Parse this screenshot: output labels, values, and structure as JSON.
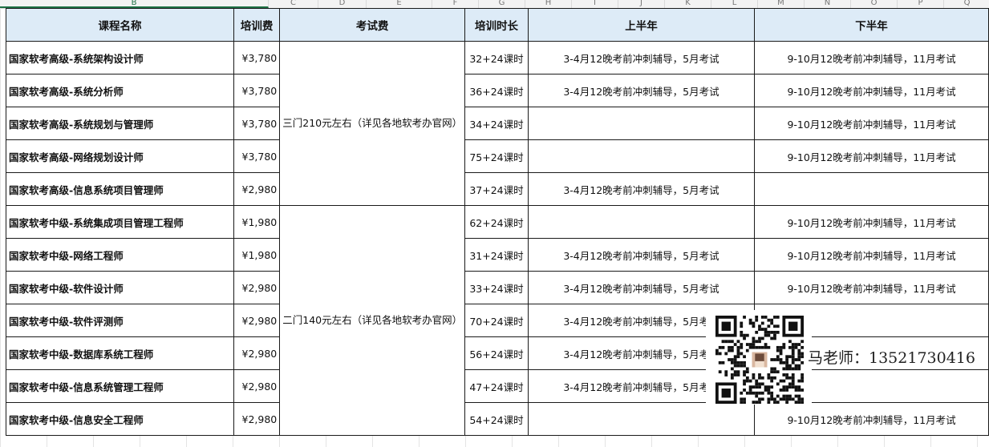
{
  "columns": [
    "B",
    "C",
    "D",
    "E",
    "F",
    "G",
    "H",
    "I",
    "J",
    "K",
    "L",
    "M",
    "N",
    "O",
    "P",
    "Q"
  ],
  "header": {
    "course": "课程名称",
    "training_fee": "培训费",
    "exam_fee": "考试费",
    "duration": "培训时长",
    "first_half": "上半年",
    "second_half": "下半年"
  },
  "exam_fee_groups": [
    {
      "text": "三门210元左右（详见各地软考办官网）",
      "rows": 5
    },
    {
      "text": "二门140元左右（详见各地软考办官网）",
      "rows": 7
    }
  ],
  "rows": [
    {
      "course": "国家软考高级-系统架构设计师",
      "fee": "¥3,780",
      "duration": "32+24课时",
      "first_half": "3-4月12晚考前冲刺辅导，5月考试",
      "second_half": "9-10月12晚考前冲刺辅导，11月考试"
    },
    {
      "course": "国家软考高级-系统分析师",
      "fee": "¥3,780",
      "duration": "36+24课时",
      "first_half": "3-4月12晚考前冲刺辅导，5月考试",
      "second_half": "9-10月12晚考前冲刺辅导，11月考试"
    },
    {
      "course": "国家软考高级-系统规划与管理师",
      "fee": "¥3,780",
      "duration": "34+24课时",
      "first_half": "",
      "second_half": "9-10月12晚考前冲刺辅导，11月考试"
    },
    {
      "course": "国家软考高级-网络规划设计师",
      "fee": "¥3,780",
      "duration": "75+24课时",
      "first_half": "",
      "second_half": "9-10月12晚考前冲刺辅导，11月考试"
    },
    {
      "course": "国家软考高级-信息系统项目管理师",
      "fee": "¥2,980",
      "duration": "37+24课时",
      "first_half": "3-4月12晚考前冲刺辅导，5月考试",
      "second_half": ""
    },
    {
      "course": "国家软考中级-系统集成项目管理工程师",
      "fee": "¥1,980",
      "duration": "62+24课时",
      "first_half": "",
      "second_half": "9-10月12晚考前冲刺辅导，11月考试"
    },
    {
      "course": "国家软考中级-网络工程师",
      "fee": "¥1,980",
      "duration": "31+24课时",
      "first_half": "3-4月12晚考前冲刺辅导，5月考试",
      "second_half": "9-10月12晚考前冲刺辅导，11月考试"
    },
    {
      "course": "国家软考中级-软件设计师",
      "fee": "¥2,980",
      "duration": "33+24课时",
      "first_half": "3-4月12晚考前冲刺辅导，5月考试",
      "second_half": "9-10月12晚考前冲刺辅导，11月考试"
    },
    {
      "course": "国家软考中级-软件评测师",
      "fee": "¥2,980",
      "duration": "70+24课时",
      "first_half": "3-4月12晚考前冲刺辅导，5月考试",
      "second_half": ""
    },
    {
      "course": "国家软考中级-数据库系统工程师",
      "fee": "¥2,980",
      "duration": "56+24课时",
      "first_half": "3-4月12晚考前冲刺辅导，5月考试",
      "second_half": ""
    },
    {
      "course": "国家软考中级-信息系统管理工程师",
      "fee": "¥2,980",
      "duration": "47+24课时",
      "first_half": "3-4月12晚考前冲刺辅导，5月考试",
      "second_half": ""
    },
    {
      "course": "国家软考中级-信息安全工程师",
      "fee": "¥2,980",
      "duration": "54+24课时",
      "first_half": "",
      "second_half": "9-10月12晚考前冲刺辅导，11月考试"
    }
  ],
  "contact": "马老师：13521730416",
  "qr_code_icon": "qr-code-icon",
  "colors": {
    "header_bg": "#ddebf7",
    "border": "#1a1a1a",
    "selected_col": "#1e7145"
  }
}
